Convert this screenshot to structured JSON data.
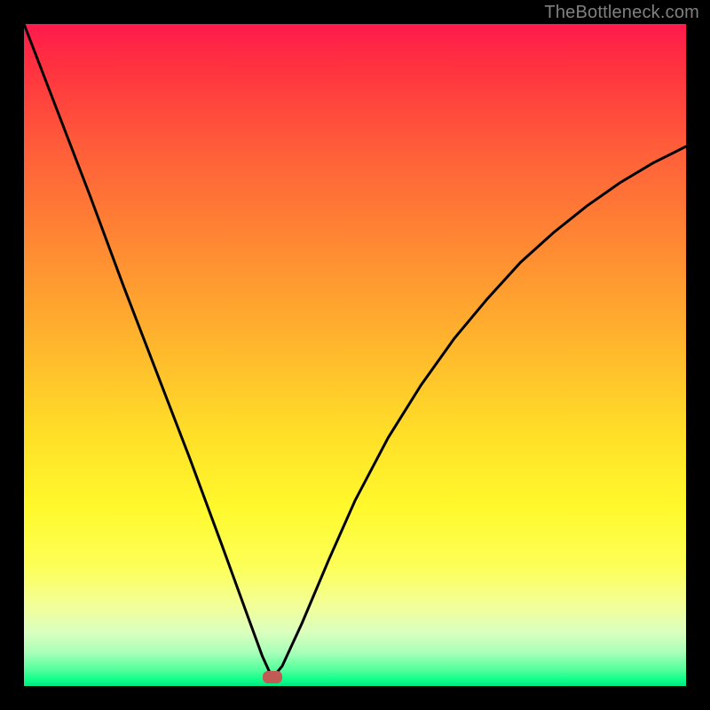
{
  "attribution": "TheBottleneck.com",
  "chart_data": {
    "type": "line",
    "title": "",
    "xlabel": "",
    "ylabel": "",
    "xlim": [
      0,
      1
    ],
    "ylim": [
      0,
      1
    ],
    "minimum_x": 0.375,
    "series": [
      {
        "name": "bottleneck-curve",
        "x": [
          0.0,
          0.05,
          0.1,
          0.15,
          0.2,
          0.25,
          0.3,
          0.34,
          0.36,
          0.375,
          0.39,
          0.42,
          0.46,
          0.5,
          0.55,
          0.6,
          0.65,
          0.7,
          0.75,
          0.8,
          0.85,
          0.9,
          0.95,
          1.0
        ],
        "y": [
          1.0,
          0.87,
          0.74,
          0.605,
          0.475,
          0.345,
          0.21,
          0.1,
          0.045,
          0.012,
          0.03,
          0.095,
          0.19,
          0.28,
          0.375,
          0.455,
          0.525,
          0.585,
          0.64,
          0.685,
          0.725,
          0.76,
          0.79,
          0.815
        ]
      }
    ],
    "marker": {
      "x": 0.375,
      "y": 0.014
    },
    "gradient_stops": [
      {
        "pos": 0.0,
        "color": "#ff1a4d"
      },
      {
        "pos": 0.5,
        "color": "#ffc82b"
      },
      {
        "pos": 0.8,
        "color": "#fcff4a"
      },
      {
        "pos": 1.0,
        "color": "#00e884"
      }
    ]
  }
}
